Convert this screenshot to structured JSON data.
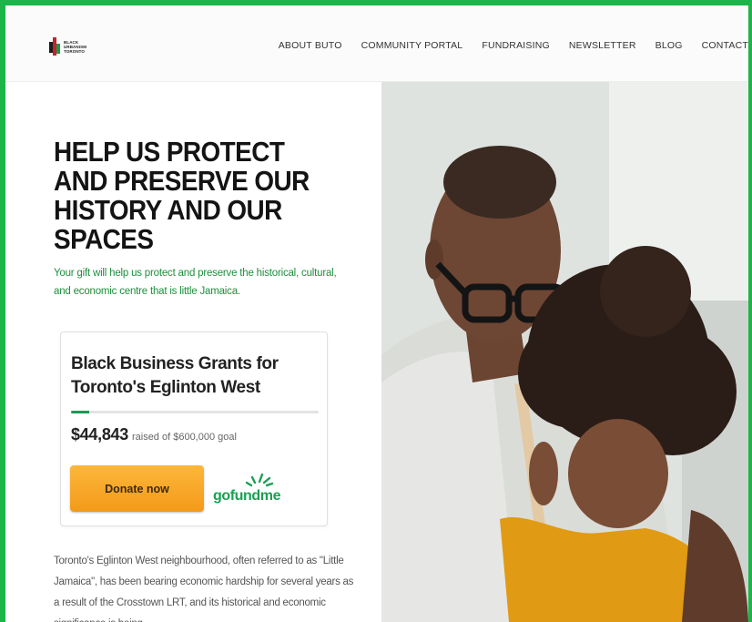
{
  "logo": {
    "line1": "BLACK",
    "line2": "URBANISM",
    "line3": "TORONTO",
    "colors": [
      "#1c1c1c",
      "#c8202f",
      "#169a48"
    ]
  },
  "nav": {
    "items": [
      "ABOUT BUTO",
      "COMMUNITY PORTAL",
      "FUNDRAISING",
      "NEWSLETTER",
      "BLOG",
      "CONTACT"
    ]
  },
  "hero": {
    "title": "HELP US PROTECT AND PRESERVE OUR HISTORY AND OUR SPACES",
    "intro": "Your gift will help us protect and preserve the historical, cultural, and economic centre that is little Jamaica."
  },
  "campaign": {
    "title": "Black Business Grants for Toronto's Eglinton West",
    "raised_amount": "$44,843",
    "raised_suffix": "raised of $600,000 goal",
    "progress_fraction": 0.075,
    "donate_label": "Donate now",
    "provider": "gofundme",
    "accent_color": "#1aa053",
    "button_color": "#f5a623"
  },
  "body": {
    "paragraph": "Toronto's Eglinton West neighbourhood, often referred to as \"Little Jamaica\", has been bearing economic hardship for several years as a result of the Crosstown LRT, and its historical and economic significance is being"
  },
  "image": {
    "description_icon": "photo-father-and-child"
  }
}
